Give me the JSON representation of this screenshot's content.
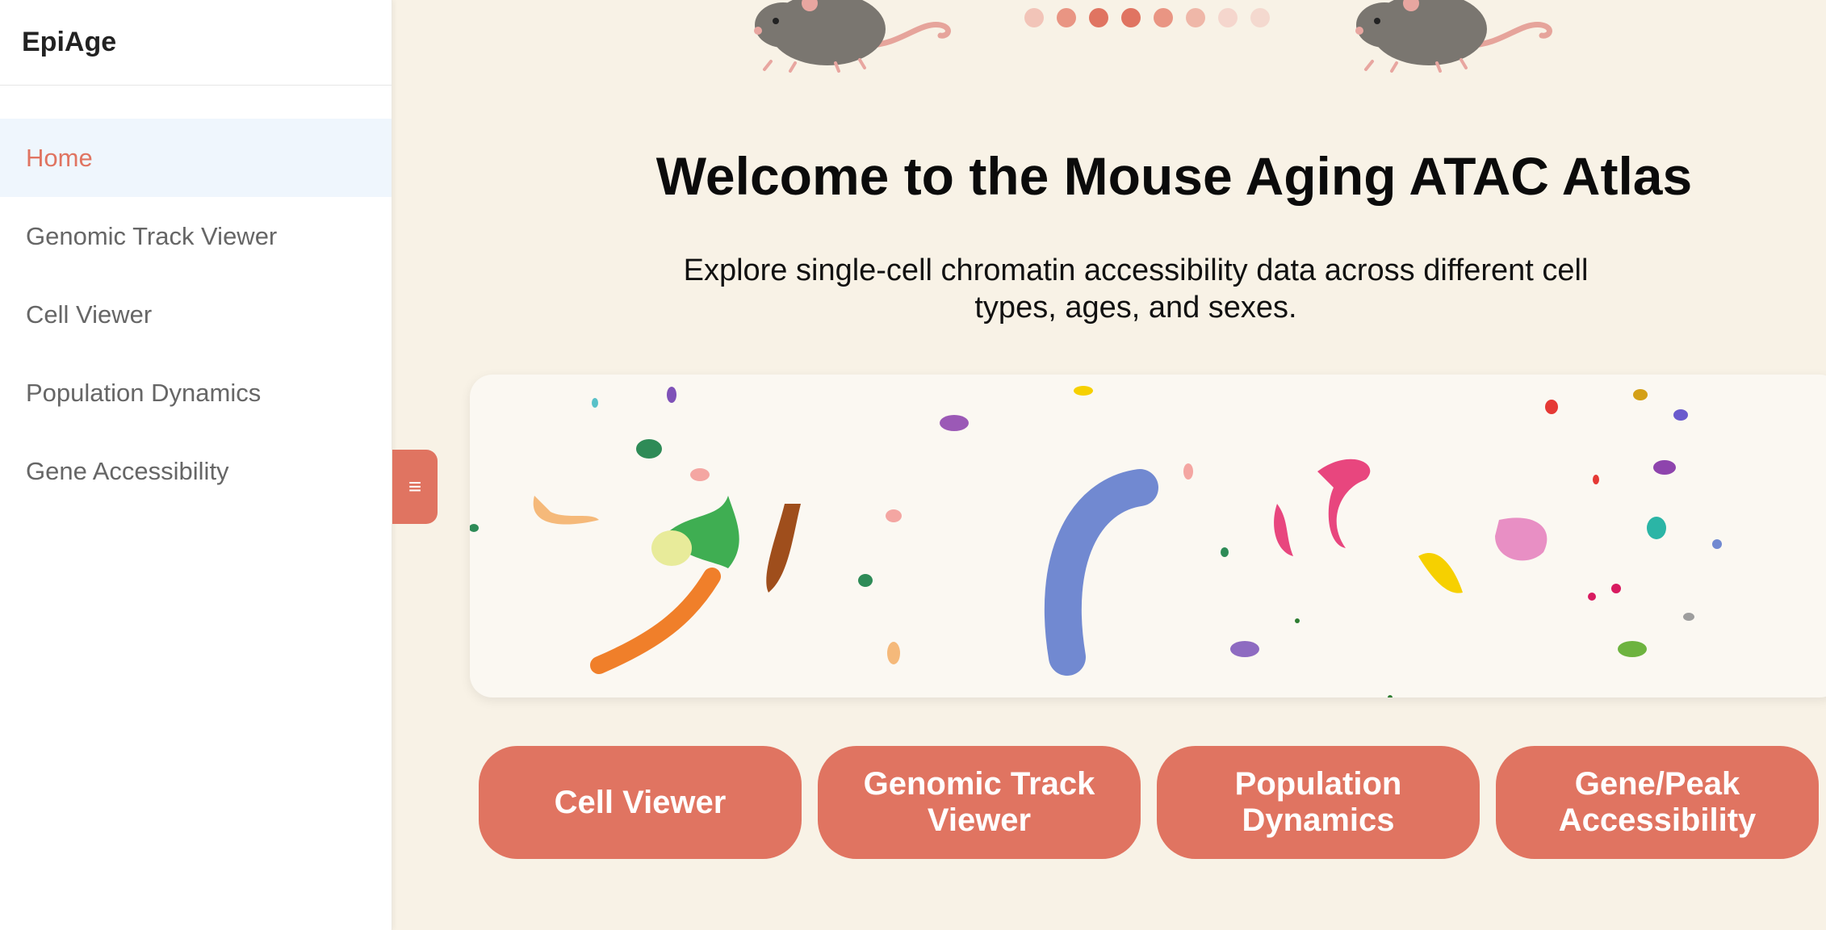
{
  "app": {
    "brand": "EpiAge"
  },
  "sidebar": {
    "items": [
      {
        "label": "Home",
        "active": true
      },
      {
        "label": "Genomic Track Viewer"
      },
      {
        "label": "Cell Viewer"
      },
      {
        "label": "Population Dynamics"
      },
      {
        "label": "Gene Accessibility"
      }
    ],
    "collapse_icon": "hamburger-icon"
  },
  "carousel": {
    "dot_colors": [
      "#f2c4b8",
      "#e99583",
      "#e07461",
      "#e07461",
      "#e99583",
      "#efb7a8",
      "#f5d6cd",
      "#f4d9cf"
    ]
  },
  "hero": {
    "title": "Welcome to the Mouse Aging ATAC Atlas",
    "subtitle": "Explore single-cell chromatin accessibility data across different cell types, ages, and sexes."
  },
  "actions": [
    {
      "label": "Cell Viewer"
    },
    {
      "label": "Genomic Track Viewer"
    },
    {
      "label": "Population Dynamics"
    },
    {
      "label": "Gene/Peak Accessibility"
    }
  ],
  "colors": {
    "accent": "#e07461",
    "background": "#f8f2e6",
    "active_bg": "#eff6fd"
  }
}
